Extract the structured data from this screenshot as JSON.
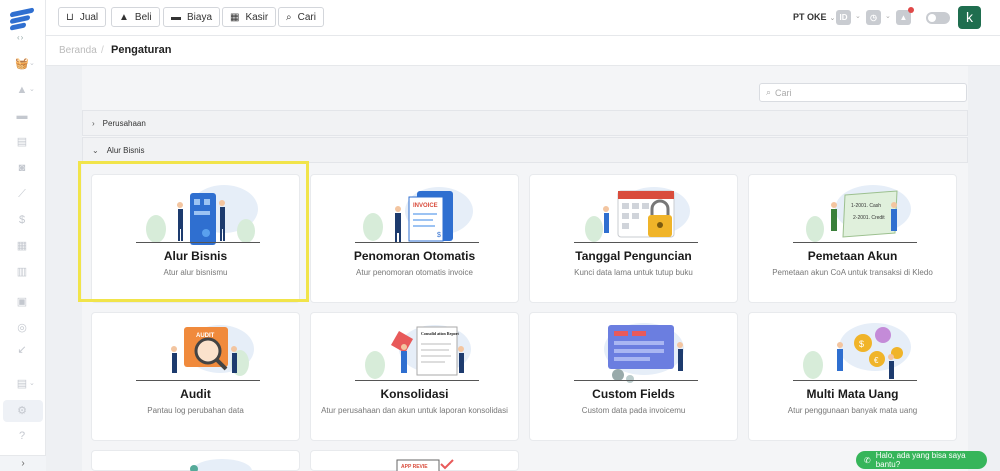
{
  "topbar": {
    "buttons": [
      {
        "label": "Jual",
        "icon": "basket-icon"
      },
      {
        "label": "Beli",
        "icon": "bag-icon"
      },
      {
        "label": "Biaya",
        "icon": "wallet-icon"
      },
      {
        "label": "Kasir",
        "icon": "cashier-icon"
      },
      {
        "label": "Cari",
        "icon": "search-icon"
      }
    ],
    "company": "PT OKE",
    "language": "ID",
    "avatar_letter": "k"
  },
  "breadcrumb": {
    "home": "Beranda",
    "current": "Pengaturan"
  },
  "search": {
    "placeholder": "Cari"
  },
  "sections": [
    {
      "label": "Perusahaan",
      "expanded": false
    },
    {
      "label": "Alur Bisnis",
      "expanded": true
    }
  ],
  "cards": [
    {
      "title": "Alur Bisnis",
      "desc": "Atur alur bisnismu",
      "highlighted": true
    },
    {
      "title": "Penomoran Otomatis",
      "desc": "Atur penomoran otomatis invoice"
    },
    {
      "title": "Tanggal Penguncian",
      "desc": "Kunci data lama untuk tutup buku"
    },
    {
      "title": "Pemetaan Akun",
      "desc": "Pemetaan akun CoA untuk transaksi di Kledo"
    },
    {
      "title": "Audit",
      "desc": "Pantau log perubahan data"
    },
    {
      "title": "Konsolidasi",
      "desc": "Atur perusahaan dan akun untuk laporan konsolidasi"
    },
    {
      "title": "Custom Fields",
      "desc": "Custom data pada invoicemu"
    },
    {
      "title": "Multi Mata Uang",
      "desc": "Atur penggunaan banyak mata uang"
    }
  ],
  "illustration_text": {
    "invoice": "INVOICE",
    "audit": "AUDIT",
    "konsolidasi": "Consolid ation Report",
    "coa1": "1-2001. Cash",
    "coa2": "2-2001. Credit",
    "app_review": "APP REVIE"
  },
  "chat": {
    "label": "Halo, ada yang bisa saya bantu?"
  },
  "colors": {
    "brand": "#2f6fd0",
    "highlight": "#f1e44a",
    "chat": "#36b55a",
    "avatar": "#1f6e4f"
  }
}
